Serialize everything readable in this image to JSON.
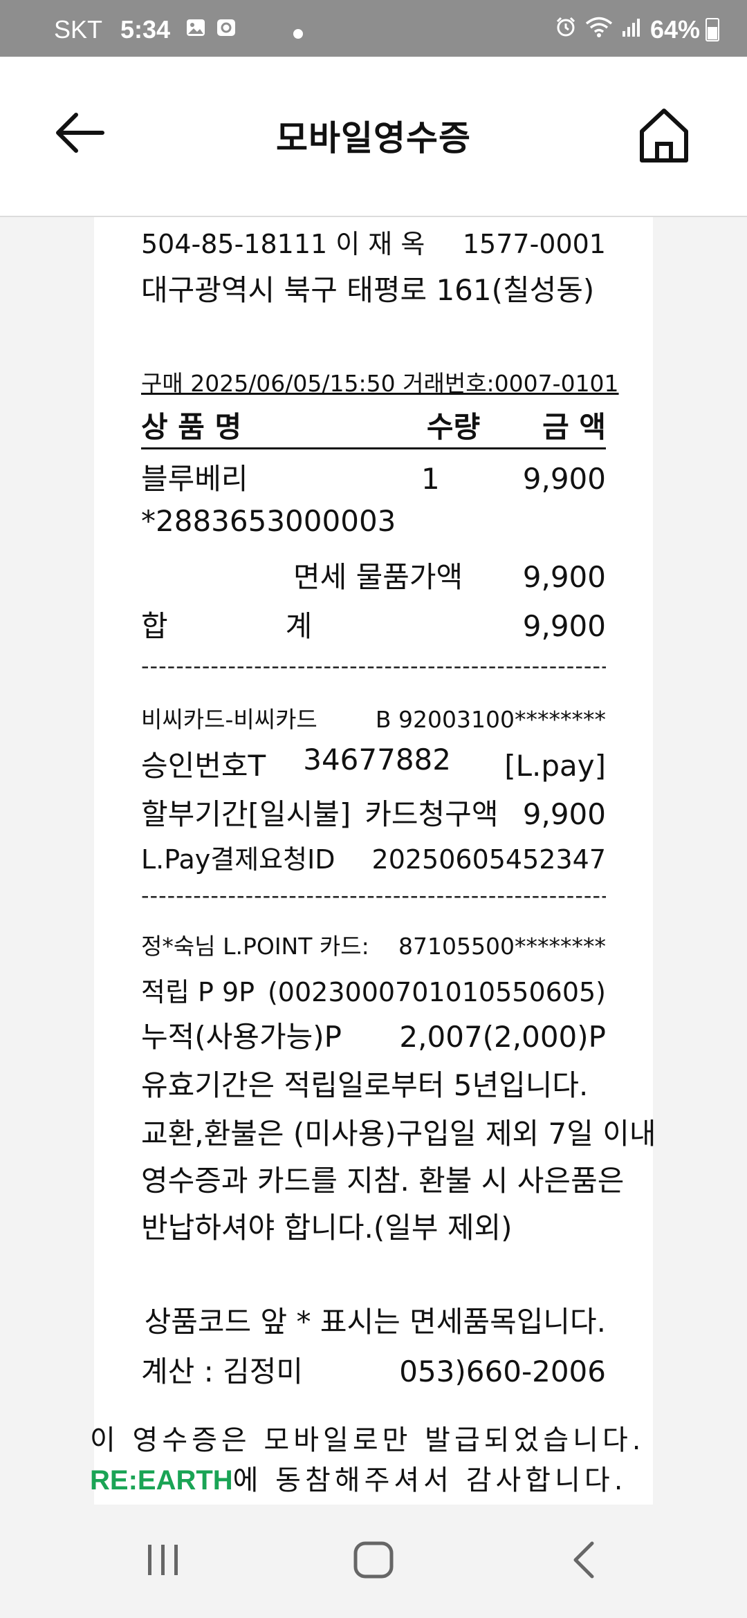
{
  "status_bar": {
    "carrier": "SKT",
    "time": "5:34",
    "battery": "64%"
  },
  "header": {
    "title": "모바일영수증"
  },
  "receipt": {
    "biz_line": {
      "reg": "504-85-18111 이 재 옥",
      "phone": "1577-0001"
    },
    "address": "대구광역시 북구 태평로 161(칠성동)",
    "purchase_line": "구매 2025/06/05/15:50 거래번호:0007-0101",
    "columns": {
      "name": "상 품 명",
      "qty": "수량",
      "amount": "금 액"
    },
    "item": {
      "name": "블루베리",
      "qty": "1",
      "amount": "9,900",
      "code": "*2883653000003"
    },
    "taxfree_label": "면세 물품가액",
    "taxfree_value": "9,900",
    "total_label_a": "합",
    "total_label_b": "계",
    "total_value": "9,900",
    "dashes": "------------------------------------------------------",
    "card_line": {
      "name": "비씨카드-비씨카드",
      "number": "B 92003100********"
    },
    "approval_line": {
      "label": "승인번호T",
      "number": "34677882",
      "method": "[L.pay]"
    },
    "installment_line": {
      "label": "할부기간[일시불]",
      "mid": "카드청구액",
      "value": "9,900"
    },
    "lpay_line": {
      "label": "L.Pay결제요청ID",
      "value": "20250605452347"
    },
    "member_line": {
      "label": "정*숙님 L.POINT 카드:",
      "value": "87105500********"
    },
    "earn_line": {
      "label": "적립 P 9P",
      "value": "(00230007010105506​05)"
    },
    "accum_line": {
      "label": "누적(사용가능)P",
      "value": "2,007(2,000)P"
    },
    "validity": "유효기간은 적립일로부터 5년입니다.",
    "refund_1": "교환,환불은 (미사용)구입일 제외 7일 이내",
    "refund_2": "영수증과 카드를 지참. 환불 시 사은품은",
    "refund_3": "반납하셔야 합니다.(일부 제외)",
    "taxfree_notice": "상품코드 앞 * 표시는 면세품목입니다.",
    "cashier_line": {
      "label": "계산 : 김정미",
      "phone": "053)660-2006"
    }
  },
  "footer_notice": {
    "line1": "이 영수증은 모바일로만 발급되었습니다.",
    "logo": "RE:EARTH",
    "line2": "에 동참해주셔서 감사합니다."
  }
}
